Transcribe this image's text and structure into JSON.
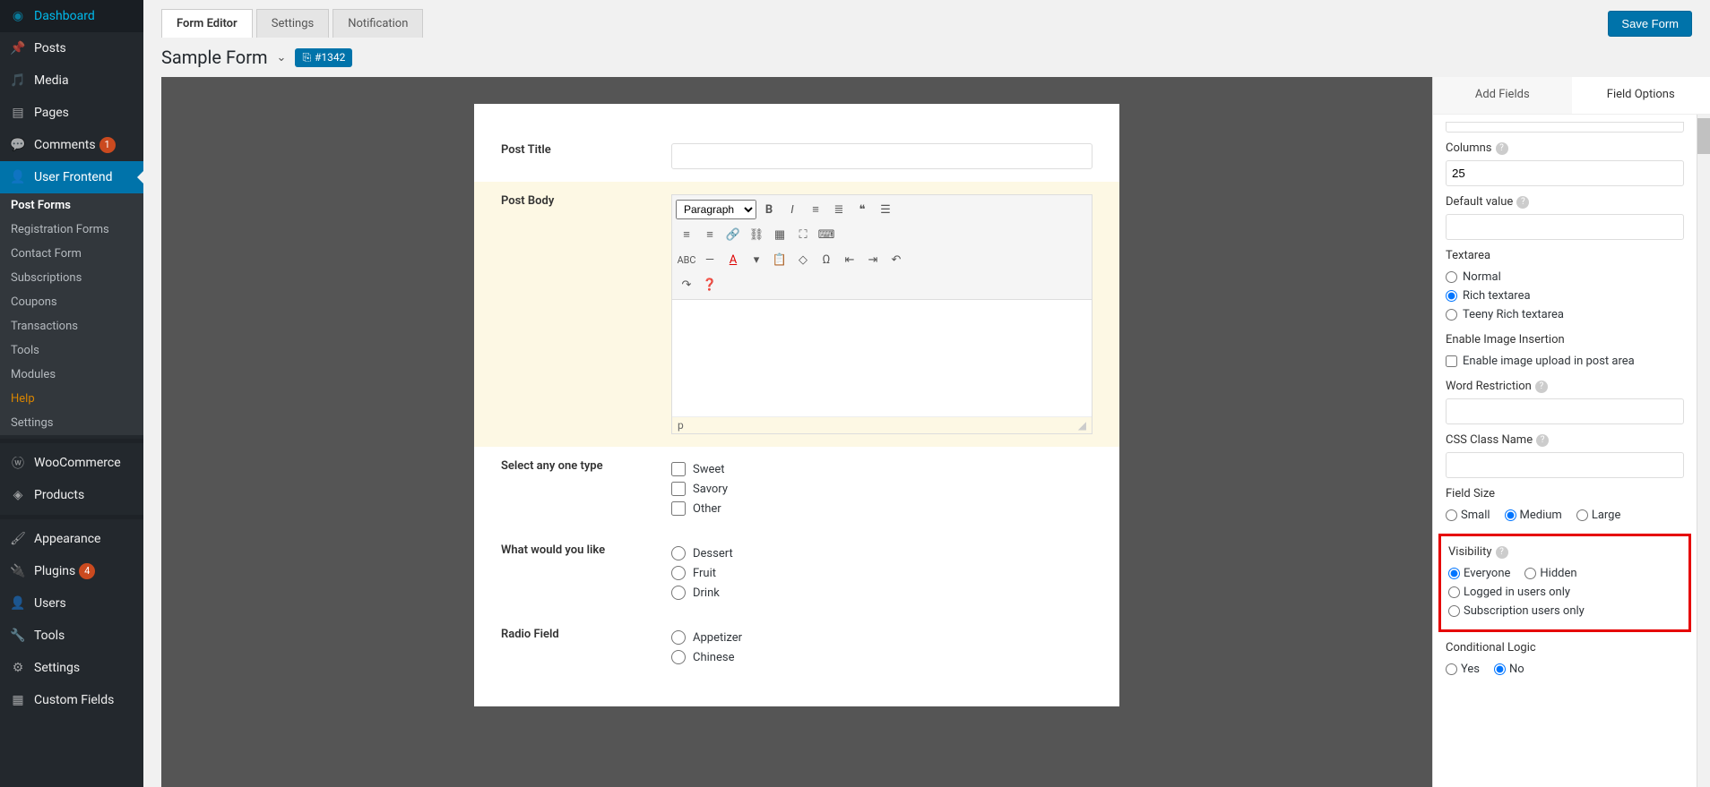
{
  "sidebar": {
    "items": [
      {
        "icon": "dashboard",
        "label": "Dashboard"
      },
      {
        "icon": "pin",
        "label": "Posts"
      },
      {
        "icon": "media",
        "label": "Media"
      },
      {
        "icon": "page",
        "label": "Pages"
      },
      {
        "icon": "comment",
        "label": "Comments",
        "badge": "1"
      },
      {
        "icon": "uf",
        "label": "User Frontend",
        "active": true,
        "submenu": [
          {
            "label": "Post Forms",
            "current": true
          },
          {
            "label": "Registration Forms"
          },
          {
            "label": "Contact Form"
          },
          {
            "label": "Subscriptions"
          },
          {
            "label": "Coupons"
          },
          {
            "label": "Transactions"
          },
          {
            "label": "Tools"
          },
          {
            "label": "Modules"
          },
          {
            "label": "Help",
            "help": true
          },
          {
            "label": "Settings"
          }
        ]
      },
      {
        "icon": "woo",
        "label": "WooCommerce",
        "sep_before": true
      },
      {
        "icon": "product",
        "label": "Products"
      },
      {
        "icon": "appearance",
        "label": "Appearance",
        "sep_before": true
      },
      {
        "icon": "plugin",
        "label": "Plugins",
        "badge": "4"
      },
      {
        "icon": "users",
        "label": "Users"
      },
      {
        "icon": "tools",
        "label": "Tools"
      },
      {
        "icon": "settings",
        "label": "Settings"
      },
      {
        "icon": "cf",
        "label": "Custom Fields"
      }
    ]
  },
  "tabs": {
    "editor": "Form Editor",
    "settings": "Settings",
    "notification": "Notification"
  },
  "save_label": "Save Form",
  "form": {
    "title": "Sample Form",
    "id_label": "#1342"
  },
  "fields": {
    "post_title": {
      "label": "Post Title"
    },
    "post_body": {
      "label": "Post Body",
      "format": "Paragraph",
      "status": "p"
    },
    "select_type": {
      "label": "Select any one type",
      "options": [
        "Sweet",
        "Savory",
        "Other"
      ]
    },
    "what_like": {
      "label": "What would you like",
      "options": [
        "Dessert",
        "Fruit",
        "Drink"
      ]
    },
    "radio_field": {
      "label": "Radio Field",
      "options": [
        "Appetizer",
        "Chinese"
      ]
    }
  },
  "right": {
    "tabs": {
      "add": "Add Fields",
      "options": "Field Options"
    },
    "columns": {
      "label": "Columns",
      "value": "25"
    },
    "default_value": {
      "label": "Default value"
    },
    "textarea": {
      "label": "Textarea",
      "options": [
        "Normal",
        "Rich textarea",
        "Teeny Rich textarea"
      ],
      "selected": "Rich textarea"
    },
    "image_insertion": {
      "label": "Enable Image Insertion",
      "checkbox": "Enable image upload in post area"
    },
    "word_restriction": {
      "label": "Word Restriction"
    },
    "css_class": {
      "label": "CSS Class Name"
    },
    "field_size": {
      "label": "Field Size",
      "options": [
        "Small",
        "Medium",
        "Large"
      ],
      "selected": "Medium"
    },
    "visibility": {
      "label": "Visibility",
      "options": [
        "Everyone",
        "Hidden",
        "Logged in users only",
        "Subscription users only"
      ],
      "selected": "Everyone"
    },
    "conditional": {
      "label": "Conditional Logic",
      "options": [
        "Yes",
        "No"
      ],
      "selected": "No"
    }
  }
}
